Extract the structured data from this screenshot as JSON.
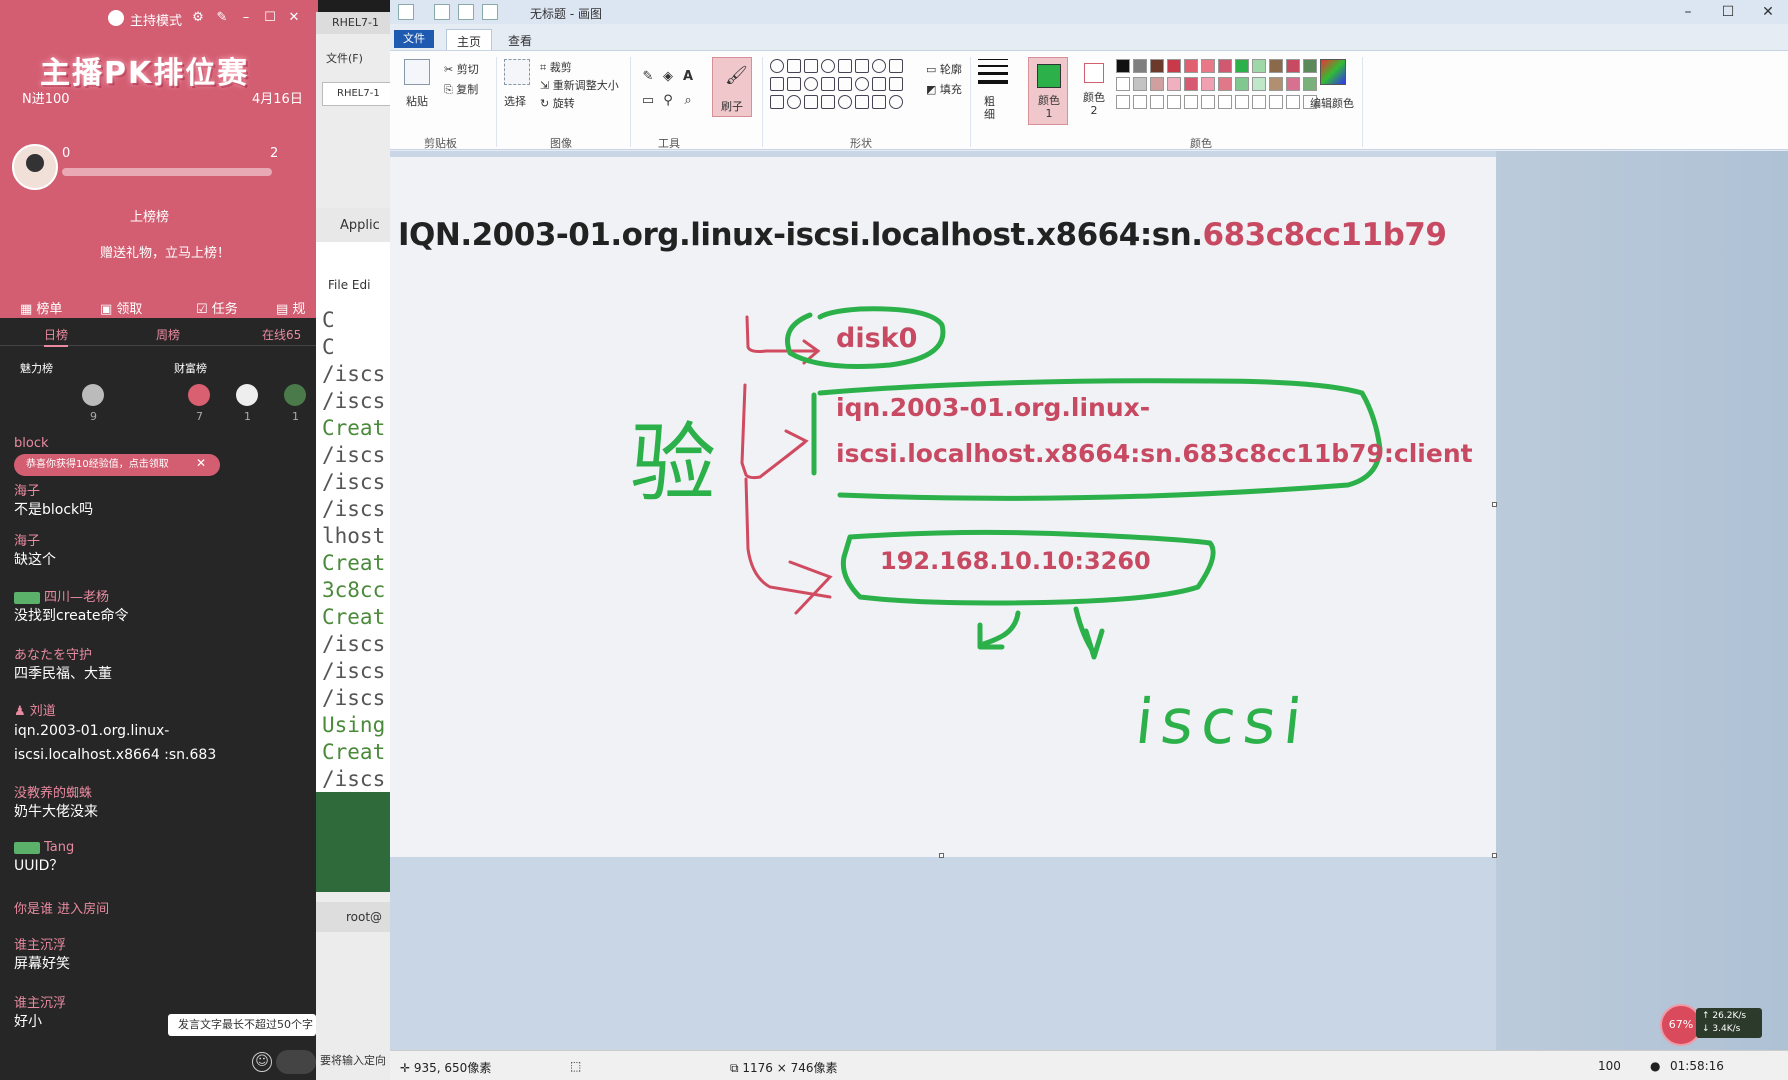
{
  "stream": {
    "mode_label": "主持模式",
    "banner_title": "主播PK排位赛",
    "banner_left": "N进100",
    "banner_right": "4月16日",
    "score_left": "0",
    "score_right": "2",
    "rank_link": "上榜榜",
    "gift_tip": "赠送礼物，立马上榜！",
    "tabs": [
      "榜单",
      "领取",
      "任务",
      "规"
    ],
    "day_tabs": [
      "日榜",
      "周榜",
      "在线65"
    ],
    "boards": [
      "魅力榜",
      "财富榜"
    ],
    "board_counts": [
      "9",
      "7",
      "1",
      "1"
    ],
    "popup": "恭喜你获得10经验值，点击领取",
    "chat": [
      {
        "user": "block",
        "msg": ""
      },
      {
        "user": "海子",
        "msg": "不是block吗"
      },
      {
        "user": "海子",
        "msg": "缺这个"
      },
      {
        "user": "四川—老杨",
        "msg": "没找到create命令",
        "badge": true
      },
      {
        "user": "あなたを守护",
        "msg": "四季民福、大董"
      },
      {
        "user": "刘道",
        "msg": "iqn.2003-01.org.linux-iscsi.localhost.x8664 :sn.683"
      },
      {
        "user": "没教养的蜘蛛",
        "msg": "奶牛大佬没来"
      },
      {
        "user": "Tang",
        "msg": "UUID？",
        "badge": true
      },
      {
        "user": "你是谁 进入房间",
        "msg": ""
      },
      {
        "user": "谁主沉浮",
        "msg": "屏幕好笑"
      },
      {
        "user": "谁主沉浮",
        "msg": "好小"
      }
    ],
    "tooltip": "发言文字最长不超过50个字"
  },
  "bg_window": {
    "title": "RHEL7-1",
    "menu": "文件(F)",
    "tab": "RHEL7-1",
    "app": "Applic",
    "term_menu": "File Edi",
    "term_lines": [
      {
        "text": "  C",
        "green": false
      },
      {
        "text": "  C",
        "green": false
      },
      {
        "text": "/iscs",
        "green": false
      },
      {
        "text": "/iscs",
        "green": false
      },
      {
        "text": "Creat",
        "green": true
      },
      {
        "text": "/iscs",
        "green": false
      },
      {
        "text": "/iscs",
        "green": false
      },
      {
        "text": "/iscs",
        "green": false
      },
      {
        "text": "lhost",
        "green": false
      },
      {
        "text": "Creat",
        "green": true
      },
      {
        "text": "3c8cc",
        "green": true
      },
      {
        "text": "Creat",
        "green": true
      },
      {
        "text": "/iscs",
        "green": false
      },
      {
        "text": "/iscs",
        "green": false
      },
      {
        "text": "/iscs",
        "green": false
      },
      {
        "text": "Using",
        "green": true
      },
      {
        "text": "Creat",
        "green": true
      },
      {
        "text": "/iscs",
        "green": false
      }
    ],
    "root": "root@",
    "status": "要将输入定向"
  },
  "paint": {
    "title": "无标题 - 画图",
    "tabs": {
      "file": "文件",
      "home": "主页",
      "view": "查看"
    },
    "ribbon": {
      "clipboard": {
        "paste": "粘贴",
        "cut": "剪切",
        "copy": "复制",
        "label": "剪贴板"
      },
      "image": {
        "select": "选择",
        "crop": "裁剪",
        "resize": "重新调整大小",
        "rotate": "旋转",
        "label": "图像"
      },
      "tools": {
        "label": "工具",
        "brush": "刷子"
      },
      "shapes": {
        "outline": "轮廓",
        "fill": "填充",
        "label": "形状"
      },
      "size": "粗细",
      "color1": "颜色 1",
      "color2": "颜色 2",
      "colors_label": "颜色",
      "edit_colors": "编辑颜色"
    },
    "palette": [
      "#111111",
      "#7f7f7f",
      "#6b3a2a",
      "#c83a4a",
      "#e06070",
      "#e87888",
      "#d05870",
      "#2bb04a",
      "#9fd8a8",
      "#8a6a4a",
      "#c84a62",
      "#5a8a5a",
      "#ffffff",
      "#c3c3c3",
      "#d0a0a0",
      "#f0b0c0",
      "#d85a70",
      "#f0a0b0",
      "#e07888",
      "#80c890",
      "#c0e8c8",
      "#b09070",
      "#d87090",
      "#7ab07a"
    ],
    "canvas": {
      "text_prefix": "IQN.2003-01.org.linux-iscsi.localhost.x8664:sn.",
      "text_highlight": "683c8cc11b79",
      "disk": "disk0",
      "iqn_line1": "iqn.2003-01.org.linux-",
      "iqn_line2": "iscsi.localhost.x8664:sn.683c8cc11b79:client",
      "portal": "192.168.10.10:3260",
      "handwrite_verify": "验",
      "handwrite_iscsi": "iscsi"
    },
    "status": {
      "pos": "935, 650像素",
      "size": "1176 × 746像素",
      "zoom": "100"
    },
    "ink_color": "#2bb04a",
    "pen_color": "#d04a60"
  },
  "net": {
    "ball": "67%",
    "down": "26.2K/s",
    "up": "3.4K/s",
    "clock": "01:58:16"
  }
}
